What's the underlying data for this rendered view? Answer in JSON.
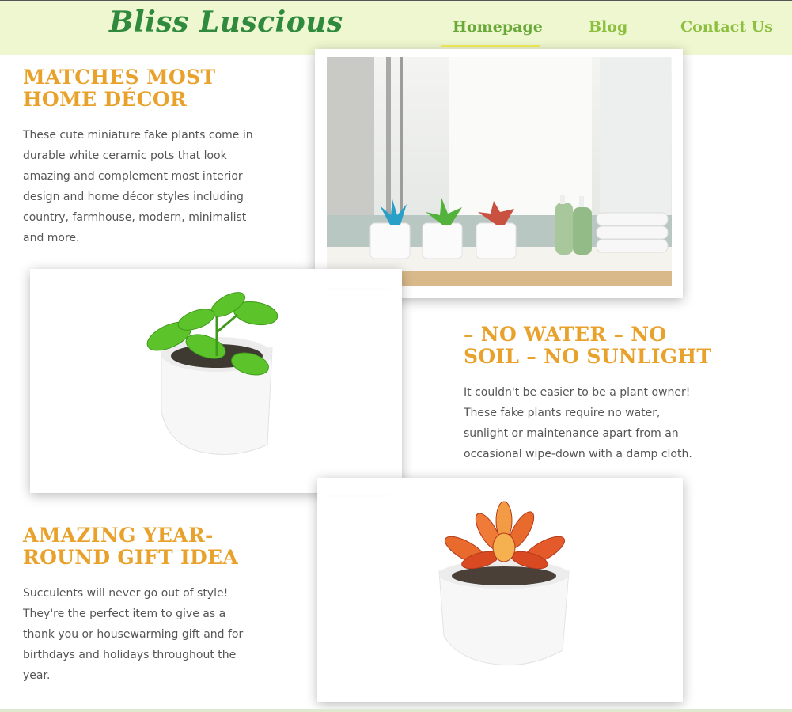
{
  "brand": {
    "logo": "Bliss Luscious"
  },
  "nav": {
    "items": [
      {
        "label": "Homepage",
        "active": true
      },
      {
        "label": "Blog",
        "active": false
      },
      {
        "label": "Contact Us",
        "active": false
      }
    ]
  },
  "sections": [
    {
      "heading_lines": [
        "MATCHES MOST",
        "HOME DÉCOR"
      ],
      "text": "These cute miniature fake plants come in durable white ceramic pots that look amazing and complement most interior design and home décor styles including country, farmhouse, modern, minimalist and more."
    },
    {
      "heading_lines": [
        "– NO WATER – NO",
        "SOIL – NO SUNLIGHT"
      ],
      "text": "It couldn't be easier to be a plant owner! These fake plants require no water, sunlight or maintenance apart from an occasional wipe-down with a damp cloth."
    },
    {
      "heading_lines": [
        "AMAZING YEAR-",
        "ROUND GIFT IDEA"
      ],
      "text": "Succulents will never go out of style! They're the perfect item to give as a thank you or housewarming gift and for birthdays and holidays throughout the year."
    }
  ],
  "colors": {
    "header_bg": "#eef7cf",
    "logo": "#2f8a3e",
    "nav": "#8cbf3f",
    "nav_underline": "#f3ef56",
    "heading": "#e8a22c",
    "body_text": "#555555"
  }
}
